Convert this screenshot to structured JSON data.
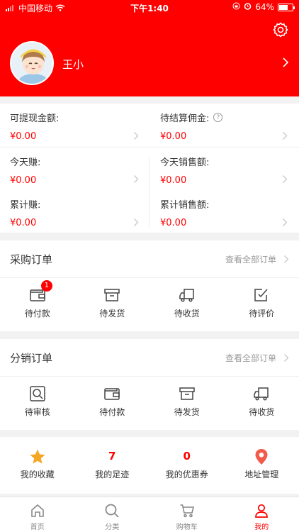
{
  "status_bar": {
    "carrier": "中国移动",
    "time": "下午1:40",
    "battery": "64%"
  },
  "profile": {
    "username": "王小"
  },
  "balance": {
    "withdrawable_label": "可提现金额:",
    "withdrawable_value": "¥0.00",
    "pending_label": "待结算佣金:",
    "pending_value": "¥0.00",
    "today_earn_label": "今天赚:",
    "today_earn_value": "¥0.00",
    "today_sales_label": "今天销售额:",
    "today_sales_value": "¥0.00",
    "total_earn_label": "累计赚:",
    "total_earn_value": "¥0.00",
    "total_sales_label": "累计销售额:",
    "total_sales_value": "¥0.00"
  },
  "purchase_orders": {
    "title": "采购订单",
    "view_all": "查看全部订单",
    "items": [
      {
        "label": "待付款",
        "badge": "1",
        "icon": "wallet-icon"
      },
      {
        "label": "待发货",
        "icon": "box-icon"
      },
      {
        "label": "待收货",
        "icon": "truck-icon"
      },
      {
        "label": "待评价",
        "icon": "review-icon"
      }
    ]
  },
  "distribution_orders": {
    "title": "分销订单",
    "view_all": "查看全部订单",
    "items": [
      {
        "label": "待审核",
        "icon": "audit-icon"
      },
      {
        "label": "待付款",
        "icon": "wallet-icon"
      },
      {
        "label": "待发货",
        "icon": "box-icon"
      },
      {
        "label": "待收货",
        "icon": "truck-icon"
      }
    ]
  },
  "quick_links": {
    "favorites_label": "我的收藏",
    "footprints_count": "7",
    "footprints_label": "我的足迹",
    "coupons_count": "0",
    "coupons_label": "我的优惠券",
    "address_label": "地址管理"
  },
  "tabbar": {
    "home": "首页",
    "category": "分类",
    "cart": "购物车",
    "mine": "我的"
  },
  "colors": {
    "brand": "#ff0000",
    "star": "#f5a623",
    "pin": "#f25a4a"
  }
}
